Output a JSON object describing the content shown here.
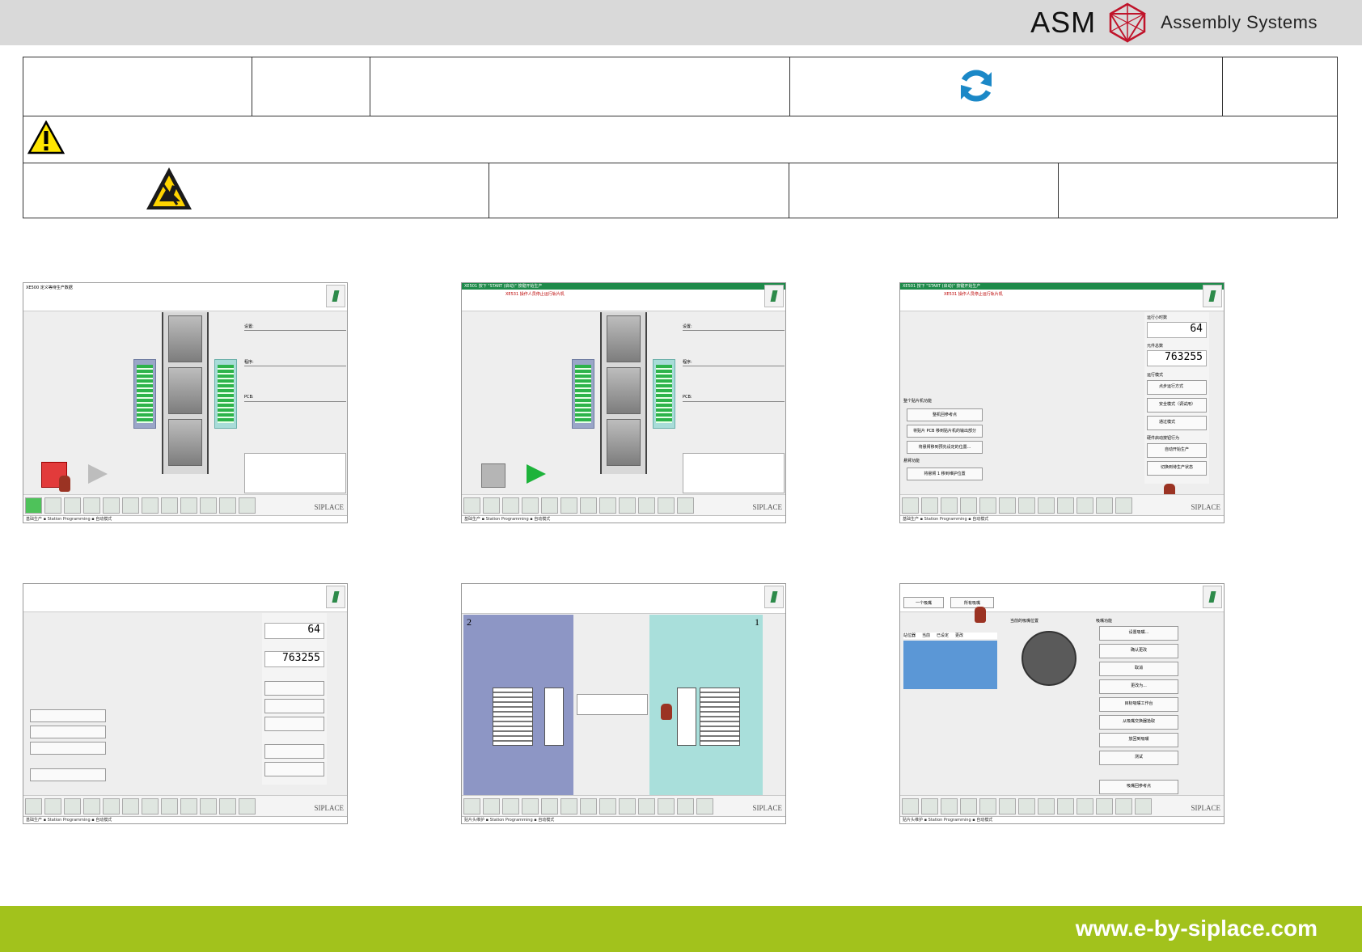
{
  "header": {
    "brand": "ASM",
    "brand_sub": "Assembly Systems"
  },
  "footer": {
    "url": "www.e-by-siplace.com"
  },
  "screens": {
    "s1": {
      "title": "XE500 定义等待生产数据",
      "siplace": "SIPLACE",
      "status": "基础生产 ▪ Station Programming ▪ 自动模式",
      "fields": [
        "设置:",
        "程序:",
        "PCB:"
      ]
    },
    "s2": {
      "green_bar": "XE501 按下 \"START (启动)\" 按键开始生产",
      "red": "XE531 操作人员停止运行轨片机",
      "siplace": "SIPLACE",
      "status": "基础生产 ▪ Station Programming ▪ 自动模式",
      "fields": [
        "设置:",
        "程序:",
        "PCB:"
      ]
    },
    "s3": {
      "green_bar": "XE501 按下 \"START (启动)\" 按键开始生产",
      "red": "XE531 操作人员停止运行轨片机",
      "siplace": "SIPLACE",
      "status": "基础生产 ▪ Station Programming ▪ 自动模式",
      "lcd1": "64",
      "lcd2": "763255",
      "lbl_hours": "运行小时数",
      "lbl_count": "元件总数",
      "lbl_mode": "运行模式",
      "modes": [
        "点步运行方式",
        "安全模式（调试用）",
        "通过模式"
      ],
      "section1": "整个贴片机功能",
      "buttons1": [
        "整机回参考点",
        "将贴片 PCB 移到贴片机的输出部分",
        "将悬臂移到预先设定的位置..."
      ],
      "section2": "悬臂功能",
      "buttons2": [
        "将悬臂 1 移到维护位置"
      ],
      "lbl_reaction": "硬件启动按钮行为",
      "reactions": [
        "自动开始生产",
        "切换到待生产状态"
      ]
    },
    "s4": {
      "siplace": "SIPLACE",
      "status": "基础生产 ▪ Station Programming ▪ 自动模式",
      "lcd1": "64",
      "lcd2": "763255"
    },
    "s5": {
      "left_num": "2",
      "right_num": "1",
      "siplace": "SIPLACE",
      "status": "贴片头维护 ▪ Station Programming ▪ 自动模式"
    },
    "s6": {
      "radio1": "一个吸嘴",
      "radio2": "所有吸嘴",
      "cols": [
        "站位器",
        "当前",
        "已设定",
        "更改"
      ],
      "wheel_title": "当前的吸嘴位置",
      "func_title": "吸嘴功能",
      "funcs": [
        "设置吸嘴...",
        "确认更改",
        "取消",
        "更改为...",
        "目标吸嘴工作台",
        "从吸嘴交换器拾取",
        "放回到吸嘴",
        "测试"
      ],
      "ref_btn": "吸嘴回参考点",
      "siplace": "SIPLACE",
      "status": "贴片头维护 ▪ Station Programming ▪ 自动模式"
    }
  }
}
